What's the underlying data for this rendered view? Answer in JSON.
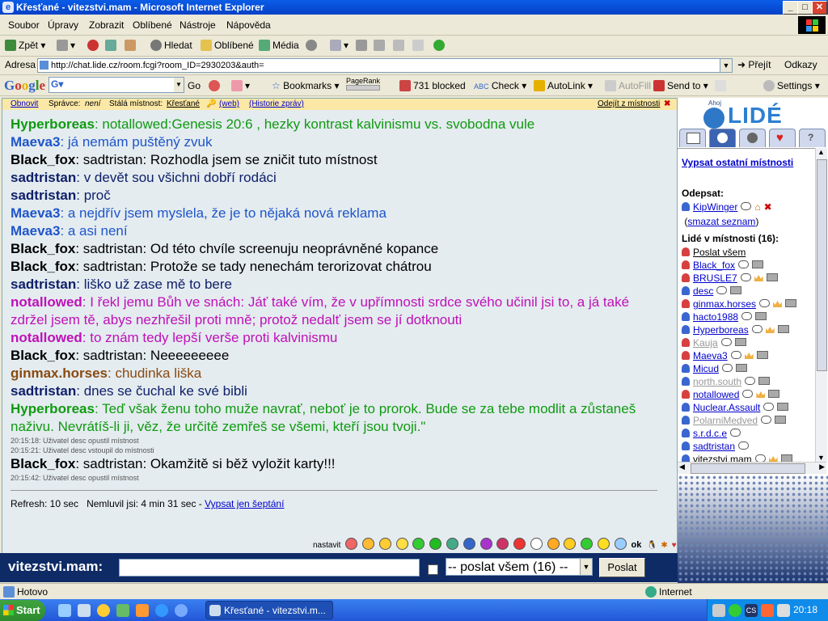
{
  "window": {
    "title": "Křesťané - vitezstvi.mam - Microsoft Internet Explorer",
    "min": "_",
    "max": "□",
    "close": "✕"
  },
  "menu": [
    "Soubor",
    "Úpravy",
    "Zobrazit",
    "Oblíbené",
    "Nástroje",
    "Nápověda"
  ],
  "toolbar": {
    "back": "Zpět",
    "search": "Hledat",
    "favorites": "Oblíbené",
    "media": "Média"
  },
  "address": {
    "label": "Adresa",
    "url": "http://chat.lide.cz/room.fcgi?room_ID=2930203&auth=",
    "go": "Přejít",
    "links": "Odkazy"
  },
  "google": {
    "logo": "Google",
    "search_value": "",
    "go": "Go",
    "bookmarks": "Bookmarks",
    "pagerank": "PageRank",
    "blocked": "731 blocked",
    "check": "Check",
    "autolink": "AutoLink",
    "autofill": "AutoFill",
    "sendto": "Send to",
    "settings": "Settings"
  },
  "chat_header": {
    "refresh": "Obnovit",
    "admin_label": "Správce:",
    "admin_value": "není",
    "permanent_label": "Stálá místnost:",
    "room_link": "Křesťané",
    "web": "(web)",
    "history": "(Historie zpráv)",
    "leave": "Odejít z místnosti"
  },
  "colors": {
    "green": "#109a10",
    "blue": "#1f55c9",
    "black": "#000000",
    "navy": "#10206a",
    "magenta": "#c010b8",
    "brown": "#8a4a10"
  },
  "messages": [
    {
      "nick": "Hyperboreas",
      "text": ": notallowed:Genesis 20:6 , hezky kontrast kalvinismu vs. svobodna vule",
      "color": "#109a10"
    },
    {
      "nick": "Maeva3",
      "text": ": já nemám puštěný zvuk",
      "color": "#1f55c9"
    },
    {
      "nick": "Black_fox",
      "text": ": sadtristan: Rozhodla jsem se zničit tuto místnost",
      "color": "#000000"
    },
    {
      "nick": "sadtristan",
      "text": ": v devět sou všichni dobří rodáci",
      "color": "#10206a"
    },
    {
      "nick": "sadtristan",
      "text": ": proč",
      "color": "#10206a"
    },
    {
      "nick": "Maeva3",
      "text": ": a nejdřív jsem myslela, že je to nějaká nová reklama",
      "color": "#1f55c9"
    },
    {
      "nick": "Maeva3",
      "text": ": a asi není",
      "color": "#1f55c9"
    },
    {
      "nick": "Black_fox",
      "text": ": sadtristan: Od této chvíle screenuju neoprávněné kopance",
      "color": "#000000"
    },
    {
      "nick": "Black_fox",
      "text": ": sadtristan: Protože se tady nenechám terorizovat chátrou",
      "color": "#000000"
    },
    {
      "nick": "sadtristan",
      "text": ": liško už zase mě to bere",
      "color": "#10206a"
    },
    {
      "nick": "notallowed",
      "text": ": I řekl jemu Bůh ve snách: Jáť také vím, že v upřímnosti srdce svého učinil jsi to, a já také zdržel jsem tě, abys nezhřešil proti mně; protož nedalť jsem se jí dotknouti",
      "color": "#c010b8"
    },
    {
      "nick": "notallowed",
      "text": ": to znám tedy lepší verše proti kalvinismu",
      "color": "#c010b8"
    },
    {
      "nick": "Black_fox",
      "text": ": sadtristan: Neeeeeeeee",
      "color": "#000000"
    },
    {
      "nick": "ginmax.horses",
      "text": ": chudinka liška",
      "color": "#8a4a10"
    },
    {
      "nick": "sadtristan",
      "text": ": dnes se čuchal ke své bibli",
      "color": "#10206a"
    },
    {
      "nick": "Hyperboreas",
      "text": ": Teď však ženu toho muže navrať, neboť je to prorok. Bude se za tebe modlit a zůstaneš naživu. Nevrátíš-li ji, věz, že určitě zemřeš se všemi, kteří jsou tvoji.\"",
      "color": "#109a10"
    }
  ],
  "system_lines": [
    "20:15:18: Uživatel desc opustil místnost",
    "20:15:21: Uživatel desc vstoupil do místnosti"
  ],
  "last_message": {
    "nick": "Black_fox",
    "text": ": sadtristan: Okamžitě si běž vyložit karty!!!",
    "color": "#000000"
  },
  "system_last": "20:15:42: Uživatel desc opustil místnost",
  "chat_status": {
    "refresh": "Refresh: 10 sec",
    "idle": "Nemluvil jsi: 4 min 31 sec -",
    "whisper_link": "Vypsat jen šeptání"
  },
  "smileys": {
    "label": "nastavit",
    "ok": "ok"
  },
  "input": {
    "nick": "vitezstvi.mam:",
    "value": "",
    "target": "-- poslat všem (16) --",
    "send": "Poslat"
  },
  "right": {
    "logo": "LIDÉ",
    "ahoj": "Ahoj",
    "list_rooms": "Vypsat ostatní místnosti",
    "unsubscribe": "Odepsat:",
    "unsub_user": "KipWinger",
    "clear_list": "smazat seznam",
    "people": "Lidé v místnosti (16):",
    "send_all": "Poslat všem",
    "users": [
      {
        "name": "Black_fox",
        "icon": "#d84040",
        "link": true,
        "crown": false
      },
      {
        "name": "BRUSLE7",
        "icon": "#d84040",
        "link": true,
        "crown": true
      },
      {
        "name": "desc",
        "icon": "#3a66d0",
        "link": true,
        "crown": false
      },
      {
        "name": "ginmax.horses",
        "icon": "#d84040",
        "link": true,
        "crown": true
      },
      {
        "name": "hacto1988",
        "icon": "#3a66d0",
        "link": true,
        "crown": false
      },
      {
        "name": "Hyperboreas",
        "icon": "#3a66d0",
        "link": true,
        "crown": true
      },
      {
        "name": "Kauja",
        "icon": "#d84040",
        "link": false,
        "crown": false
      },
      {
        "name": "Maeva3",
        "icon": "#d84040",
        "link": true,
        "crown": true
      },
      {
        "name": "Micud",
        "icon": "#3a66d0",
        "link": true,
        "crown": false
      },
      {
        "name": "north.south",
        "icon": "#3a66d0",
        "link": false,
        "crown": false
      },
      {
        "name": "notallowed",
        "icon": "#d84040",
        "link": true,
        "crown": true
      },
      {
        "name": "Nuclear.Assault",
        "icon": "#3a66d0",
        "link": true,
        "crown": false
      },
      {
        "name": "PolarniMedved",
        "icon": "#3a66d0",
        "link": false,
        "crown": false
      },
      {
        "name": "s.r.d.c.e",
        "icon": "#3a66d0",
        "link": true,
        "crown": false
      },
      {
        "name": "sadtristan",
        "icon": "#3a66d0",
        "link": true,
        "crown": false
      },
      {
        "name": "vitezstvi.mam",
        "icon": "#3a66d0",
        "link": false,
        "crown": true
      }
    ]
  },
  "statusbar": {
    "done": "Hotovo",
    "zone": "Internet"
  },
  "taskbar": {
    "start": "Start",
    "task": "Křesťané - vitezstvi.m...",
    "clock": "20:18"
  }
}
